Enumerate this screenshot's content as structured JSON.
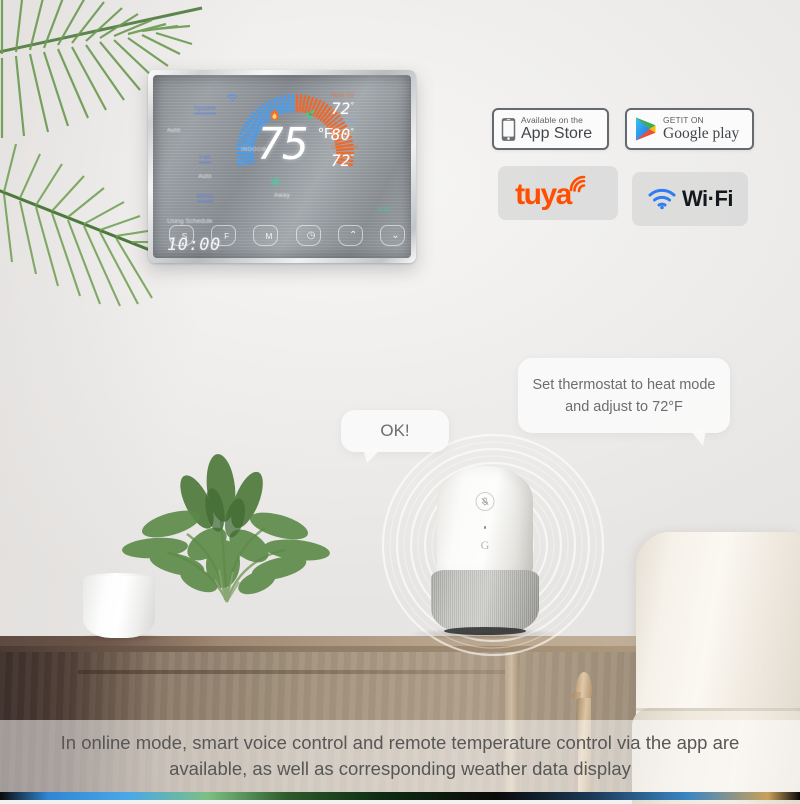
{
  "thermostat": {
    "left_labels": {
      "system_title": "System",
      "system_value": "Auto",
      "fan_title": "Fan",
      "fan_value": "Auto",
      "menu": "Menu",
      "schedule_status": "Using Schedule",
      "clock": "10:00"
    },
    "dial": {
      "indoor_label": "INDOOR",
      "current_temp": "75",
      "unit": "°F",
      "away_label": "Away",
      "flame_icon": "heat-flame-icon",
      "fan_icon": "fan-blade-icon",
      "snow_icon": "cool-snowflake-icon",
      "wifi_icon": "wifi-signal-icon",
      "arc_cool_color": "#4f9ce8",
      "arc_heat_color": "#ea6a2e",
      "arc_cool_ticks": 26,
      "arc_heat_ticks": 26
    },
    "readouts": [
      {
        "caption": "HEAT TO",
        "caption_color": "#e8703a",
        "value": "72",
        "deg": "°"
      },
      {
        "caption": "COOL TO",
        "caption_color": "#6aa6e8",
        "value": "80",
        "deg": "°"
      },
      {
        "caption": "OUTDOOR",
        "caption_color": "#e8703a",
        "value": "72",
        "deg": "°"
      }
    ],
    "sun_label": "SUN",
    "buttons": [
      {
        "label": "S",
        "name": "button-schedule"
      },
      {
        "label": "F",
        "name": "button-fan"
      },
      {
        "label": "M",
        "name": "button-mode"
      },
      {
        "label": "◷",
        "name": "button-clock"
      },
      {
        "label": "⌃",
        "name": "button-temp-up"
      },
      {
        "label": "⌄",
        "name": "button-temp-down"
      }
    ]
  },
  "badges": {
    "app_store": {
      "line1": "Available on the",
      "line2": "App Store",
      "icon": "iphone-icon"
    },
    "google_play": {
      "line1": "GETIT ON",
      "line2": "Google play",
      "icon": "google-play-triangle-icon"
    },
    "tuya": {
      "label": "tuya",
      "color": "#ff4e00",
      "icon": "tuya-signal-arc-icon"
    },
    "wifi": {
      "label": "Wi·Fi",
      "color": "#14181c",
      "icon": "wifi-fan-icon"
    }
  },
  "bubbles": {
    "command": "Set thermostat to heat mode and adjust to 72°F",
    "reply": "OK!"
  },
  "speaker": {
    "brand_letter": "G",
    "mute_icon": "microphone-mute-icon",
    "name": "google-home-speaker"
  },
  "caption": "In online mode, smart voice control and remote temperature control via the app are available, as well as corresponding weather data display",
  "scene": {
    "palm_icon": "palm-frond-decoration",
    "plant_icon": "potted-houseplant",
    "chair_icon": "armchair",
    "sideboard_icon": "wooden-sideboard"
  }
}
